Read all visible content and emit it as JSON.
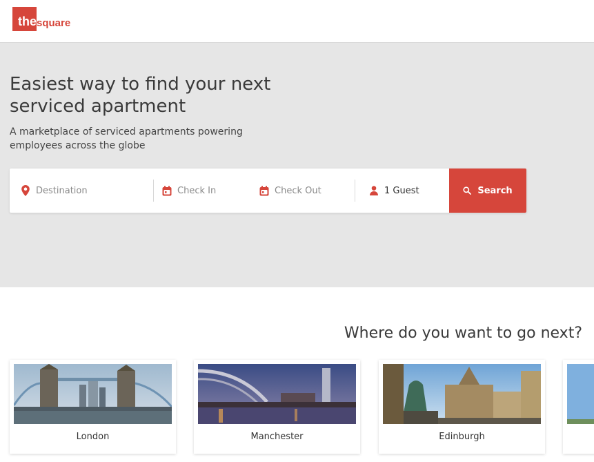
{
  "header": {
    "logo_the": "the",
    "logo_square": "square"
  },
  "hero": {
    "title_line1": "Easiest way to find your next",
    "title_line2": "serviced apartment",
    "subtitle_line1": "A marketplace of serviced apartments powering",
    "subtitle_line2": "employees across the globe"
  },
  "search": {
    "destination_placeholder": "Destination",
    "check_in_placeholder": "Check In",
    "check_out_placeholder": "Check Out",
    "guests_value": "1 Guest",
    "button_label": "Search"
  },
  "destinations": {
    "heading": "Where do you want to go next?",
    "cards": [
      {
        "name": "London"
      },
      {
        "name": "Manchester"
      },
      {
        "name": "Edinburgh"
      },
      {
        "name": ""
      }
    ]
  },
  "colors": {
    "brand": "#d6463b",
    "hero_bg": "#e6e6e6"
  }
}
